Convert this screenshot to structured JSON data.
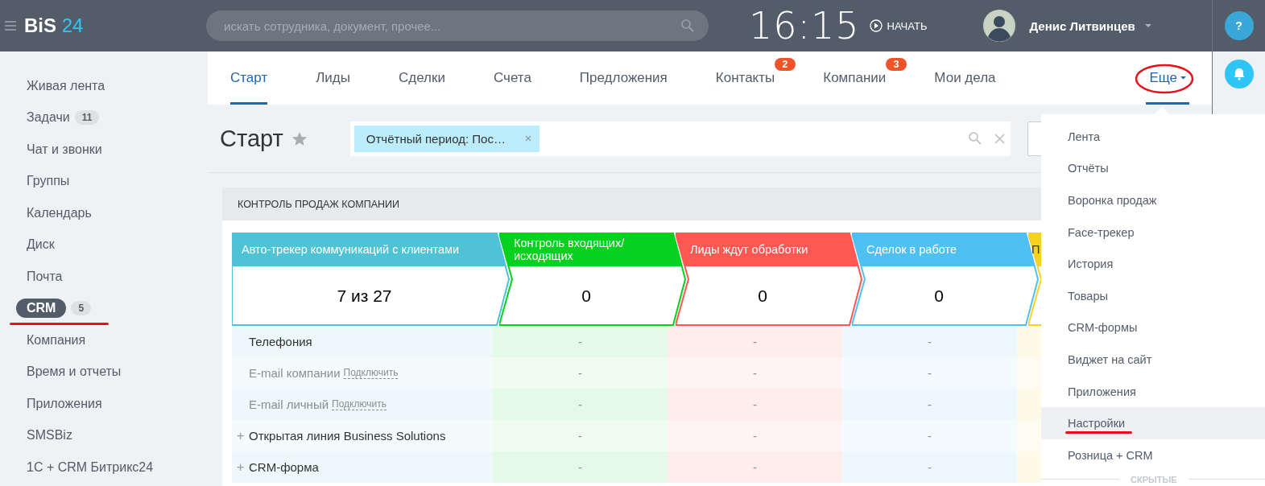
{
  "header": {
    "logo": {
      "text": "BiS",
      "accent": "24"
    },
    "search": {
      "placeholder": "искать сотрудника, документ, прочее..."
    },
    "clock": "16:15",
    "start_button": "НАЧАТЬ",
    "user": {
      "name": "Денис Литвинцев"
    }
  },
  "right_panel": {
    "help_button": "?"
  },
  "sidebar": {
    "items": [
      {
        "label": "Живая лента",
        "selected": false
      },
      {
        "label": "Задачи",
        "counter": "11",
        "selected": false
      },
      {
        "label": "Чат и звонки",
        "selected": false
      },
      {
        "label": "Группы",
        "selected": false
      },
      {
        "label": "Календарь",
        "selected": false
      },
      {
        "label": "Диск",
        "selected": false
      },
      {
        "label": "Почта",
        "selected": false
      },
      {
        "label": "CRM",
        "counter": "5",
        "selected": true,
        "marked": true
      },
      {
        "label": "Компания",
        "selected": false
      },
      {
        "label": "Время и отчеты",
        "selected": false
      },
      {
        "label": "Приложения",
        "selected": false
      },
      {
        "label": "SMSBiz",
        "selected": false
      },
      {
        "label": "1С + CRM Битрикс24",
        "selected": false
      }
    ]
  },
  "tabs": [
    {
      "label": "Старт",
      "selected": true
    },
    {
      "label": "Лиды",
      "selected": false
    },
    {
      "label": "Сделки",
      "selected": false
    },
    {
      "label": "Счета",
      "selected": false
    },
    {
      "label": "Предложения",
      "selected": false
    },
    {
      "label": "Контакты",
      "badge": "2",
      "selected": false
    },
    {
      "label": "Компании",
      "badge": "3",
      "selected": false
    },
    {
      "label": "Мои дела",
      "selected": false
    },
    {
      "label": "Еще",
      "selected": true,
      "open": true,
      "marked": true
    }
  ],
  "page": {
    "title": "Старт",
    "filter": {
      "tags": [
        {
          "label": "Отчётный период: Пос…"
        }
      ]
    }
  },
  "panel": {
    "title": "КОНТРОЛЬ ПРОДАЖ КОМПАНИИ",
    "stages": [
      {
        "title": "Авто-трекер коммуникаций с клиентами",
        "value": "7 из 27",
        "color": "#4fc3d6"
      },
      {
        "title": "Контроль входящих/ исходящих",
        "value": "0",
        "color": "#07d11f"
      },
      {
        "title": "Лиды ждут обработки",
        "value": "0",
        "color": "#ff5752"
      },
      {
        "title": "Сделок в работе",
        "value": "0",
        "color": "#4fc0f2"
      },
      {
        "title": "П",
        "color": "#f7d223"
      }
    ],
    "rows": [
      {
        "kind": "source",
        "label": "Телефония",
        "cells": [
          "-",
          "-",
          "-"
        ]
      },
      {
        "kind": "disconnected",
        "label": "E-mail компании",
        "link": "Подключить",
        "cells": [
          "-",
          "-",
          "-"
        ]
      },
      {
        "kind": "disconnected",
        "label": "E-mail личный",
        "link": "Подключить",
        "cells": [
          "-",
          "-",
          "-"
        ]
      },
      {
        "kind": "expandable",
        "toggle": "+",
        "label": "Открытая линия Business Solutions",
        "cells": [
          "-",
          "-",
          "-"
        ]
      },
      {
        "kind": "expandable",
        "toggle": "+",
        "label": "CRM-форма",
        "cells": [
          "-",
          "-",
          "-"
        ]
      }
    ]
  },
  "more_menu": {
    "items": [
      {
        "label": "Лента",
        "selected": false
      },
      {
        "label": "Отчёты",
        "selected": false
      },
      {
        "label": "Воронка продаж",
        "selected": false
      },
      {
        "label": "Face-трекер",
        "selected": false
      },
      {
        "label": "История",
        "selected": false
      },
      {
        "label": "Товары",
        "selected": false
      },
      {
        "label": "CRM-формы",
        "selected": false
      },
      {
        "label": "Виджет на сайт",
        "selected": false
      },
      {
        "label": "Приложения",
        "selected": false
      },
      {
        "label": "Настройки",
        "selected": true,
        "marked": true
      },
      {
        "label": "Розница + CRM",
        "selected": false
      }
    ],
    "section": "СКРЫТЫЕ"
  }
}
